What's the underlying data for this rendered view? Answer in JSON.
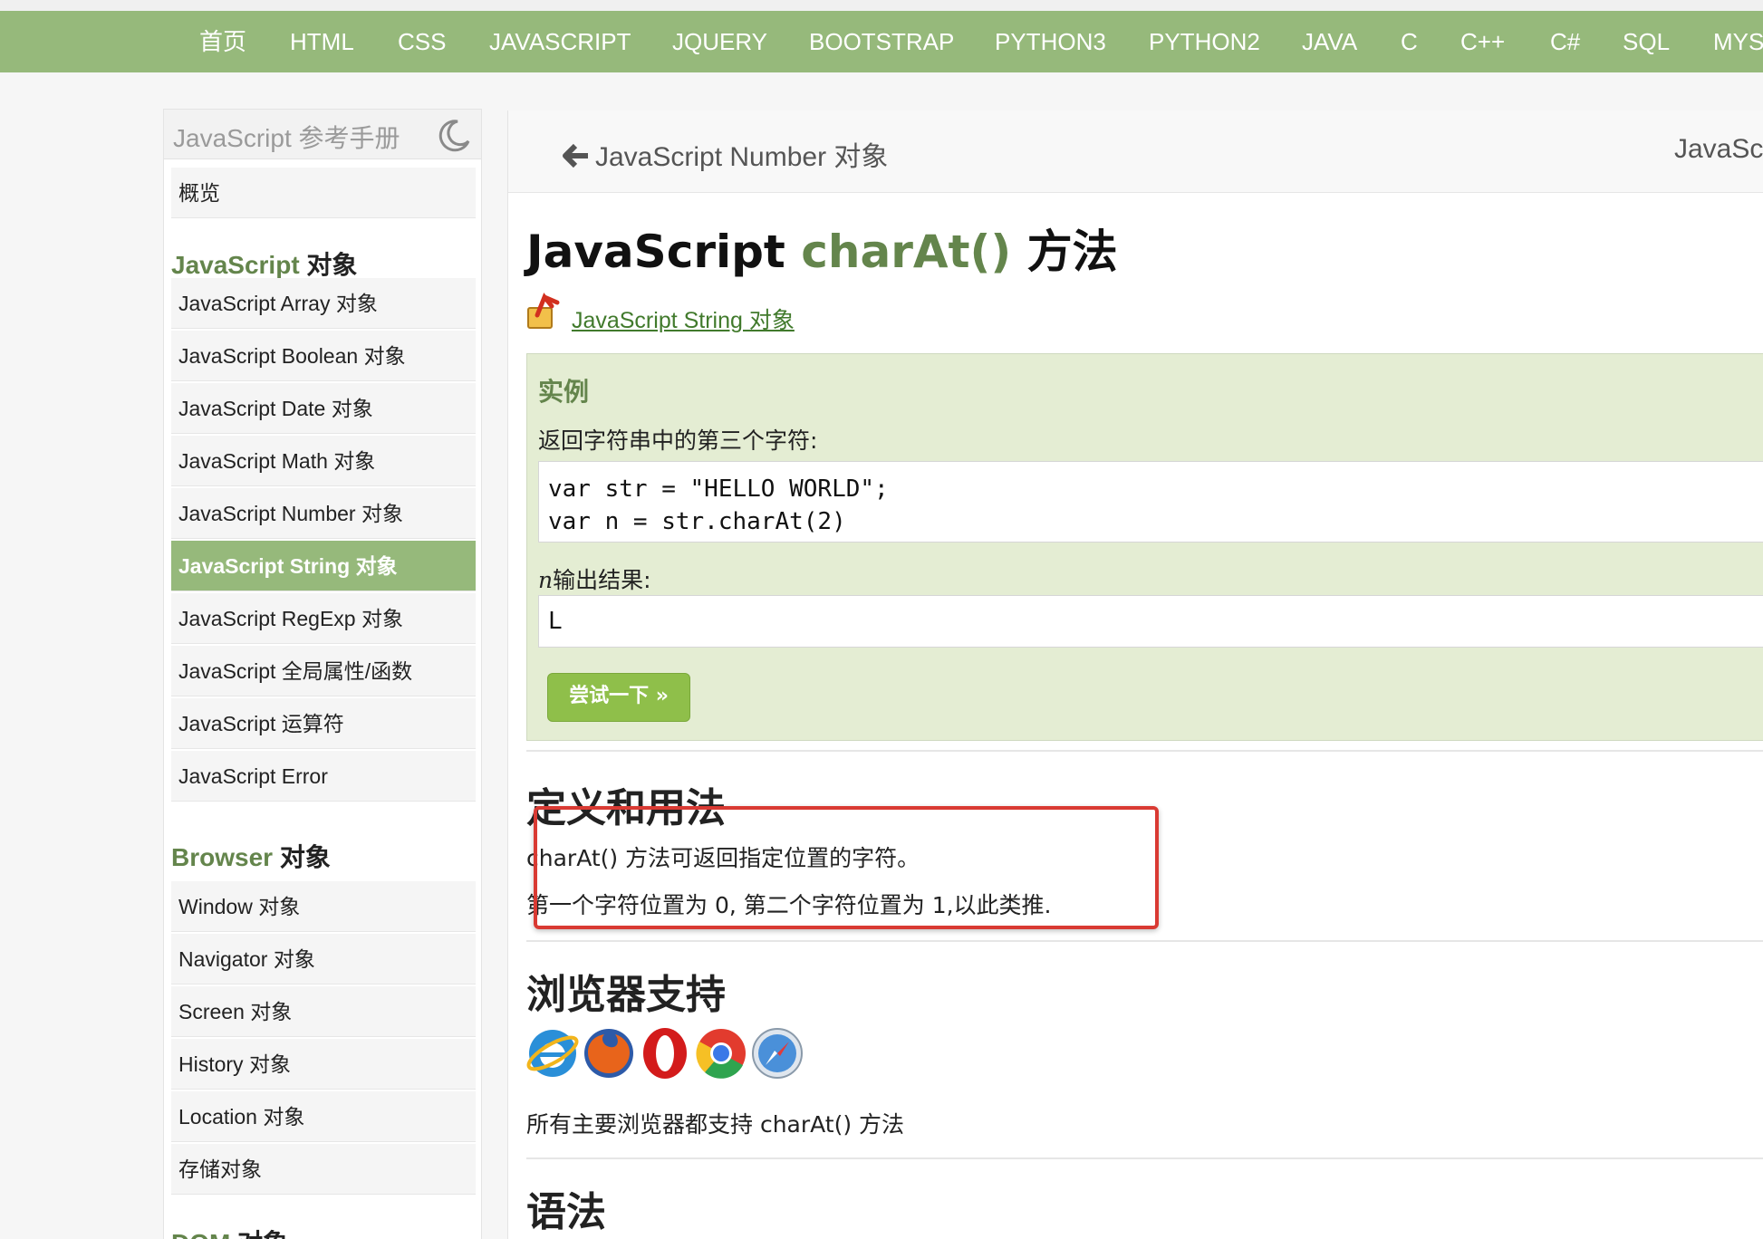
{
  "nav": {
    "items": [
      "首页",
      "HTML",
      "CSS",
      "JAVASCRIPT",
      "JQUERY",
      "BOOTSTRAP",
      "PYTHON3",
      "PYTHON2",
      "JAVA",
      "C",
      "C++",
      "C#",
      "SQL",
      "MYS"
    ]
  },
  "sidebar": {
    "title": "JavaScript 参考手册",
    "overview": "概览",
    "section1": {
      "prefix": "JavaScript",
      "suffix": " 对象"
    },
    "items1": [
      "JavaScript Array 对象",
      "JavaScript Boolean 对象",
      "JavaScript Date 对象",
      "JavaScript Math 对象",
      "JavaScript Number 对象",
      "JavaScript String 对象",
      "JavaScript RegExp 对象",
      "JavaScript 全局属性/函数",
      "JavaScript 运算符",
      "JavaScript Error"
    ],
    "active_index": 5,
    "section2": {
      "prefix": "Browser",
      "suffix": " 对象"
    },
    "items2": [
      "Window 对象",
      "Navigator 对象",
      "Screen 对象",
      "History 对象",
      "Location 对象",
      "存储对象"
    ],
    "section3": {
      "prefix": "DOM",
      "suffix": " 对象"
    }
  },
  "breadcrumb": {
    "prev": "JavaScript Number 对象",
    "next": "JavaSc"
  },
  "title": {
    "prefix": "JavaScript ",
    "method": "charAt()",
    "suffix": " 方法"
  },
  "parent_link": "JavaScript String 对象",
  "example": {
    "heading": "实例",
    "description": "返回字符串中的第三个字符:",
    "code_lines": [
      "var str = \"HELLO WORLD\";",
      "var n = str.charAt(2)"
    ],
    "output_var": "n",
    "output_label": "输出结果:",
    "output": "L",
    "try_button": "尝试一下 »"
  },
  "definition": {
    "heading": "定义和用法",
    "line1": "charAt() 方法可返回指定位置的字符。",
    "line2": "第一个字符位置为 0, 第二个字符位置为 1,以此类推."
  },
  "browser_support": {
    "heading": "浏览器支持",
    "icons": [
      "ie-icon",
      "firefox-icon",
      "opera-icon",
      "chrome-icon",
      "safari-icon"
    ],
    "text": "所有主要浏览器都支持 charAt() 方法"
  },
  "syntax": {
    "heading": "语法"
  },
  "colors": {
    "nav_bg": "#96b97b",
    "accent_green": "#64854c",
    "highlight_red": "#d93a33"
  }
}
